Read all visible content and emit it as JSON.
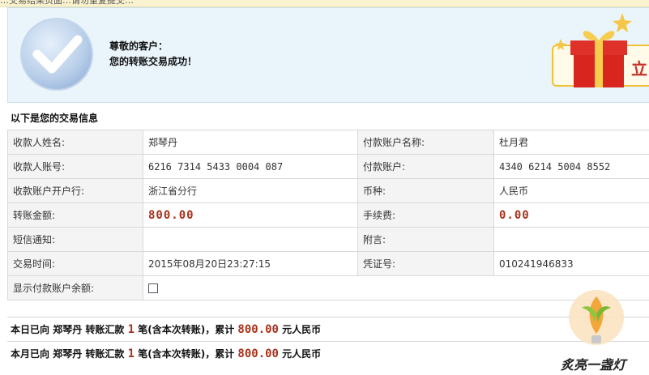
{
  "top_notice": "…交易结果页面…请勿重复提交…",
  "banner": {
    "greeting": "尊敬的客户：",
    "message": "您的转账交易成功！",
    "gift_button_label": "立"
  },
  "section_title": "以下是您的交易信息",
  "rows": [
    {
      "l1": "收款人姓名:",
      "v1": "郑琴丹",
      "l2": "付款账户名称:",
      "v2": "杜月君"
    },
    {
      "l1": "收款人账号:",
      "v1": "6216 7314 5433 0004 087",
      "l2": "付款账户:",
      "v2": "4340 6214 5004 8552"
    },
    {
      "l1": "收款账户开户行:",
      "v1": "浙江省分行",
      "l2": "币种:",
      "v2": "人民币"
    },
    {
      "l1": "转账金额:",
      "v1": "800.00",
      "l2": "手续费:",
      "v2": "0.00"
    },
    {
      "l1": "短信通知:",
      "v1": "",
      "l2": "附言:",
      "v2": ""
    },
    {
      "l1": "交易时间:",
      "v1": "2015年08月20日23:27:15",
      "l2": "凭证号:",
      "v2": "010241946833"
    },
    {
      "l1": "显示付款账户余额:"
    }
  ],
  "summary_day": {
    "prefix": "本日已向",
    "payee": "郑琴丹",
    "mid": "转账汇款",
    "count": "1",
    "unit": "笔(含本次转账)，累计",
    "amount": "800.00",
    "suffix": "元人民币"
  },
  "summary_month": {
    "prefix": "本月已向",
    "payee": "郑琴丹",
    "mid": "转账汇款",
    "count": "1",
    "unit": "笔(含本次转账)，累计",
    "amount": "800.00",
    "suffix": "元人民币"
  },
  "watermark_text": "炙亮一盏灯"
}
